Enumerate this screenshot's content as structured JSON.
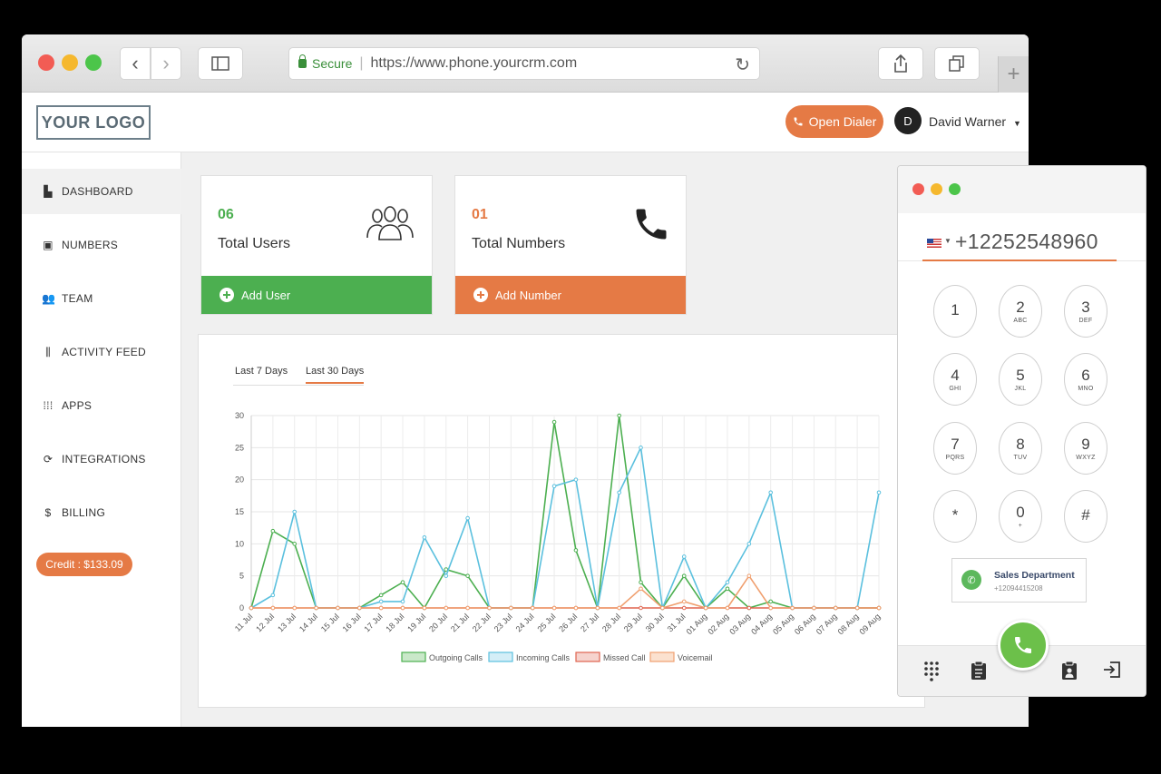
{
  "browser": {
    "url_secure": "Secure",
    "url": "https://www.phone.yourcrm.com",
    "nav_back": "‹",
    "nav_forward": "›",
    "reload": "↻",
    "new_tab": "+"
  },
  "header": {
    "logo": "YOUR LOGO",
    "open_dialer": "Open Dialer",
    "avatar_initial": "D",
    "user_name": "David Warner"
  },
  "sidebar": {
    "items": [
      {
        "label": "DASHBOARD",
        "icon": "dashboard-icon"
      },
      {
        "label": "NUMBERS",
        "icon": "numbers-icon"
      },
      {
        "label": "TEAM",
        "icon": "team-icon"
      },
      {
        "label": "ACTIVITY FEED",
        "icon": "activity-feed-icon"
      },
      {
        "label": "APPS",
        "icon": "apps-icon"
      },
      {
        "label": "INTEGRATIONS",
        "icon": "integrations-icon"
      },
      {
        "label": "BILLING",
        "icon": "billing-icon"
      }
    ],
    "credit": "Credit : $133.09"
  },
  "cards": {
    "users": {
      "count": "06",
      "label": "Total Users",
      "action": "Add User",
      "color": "#4caf50"
    },
    "numbers": {
      "count": "01",
      "label": "Total Numbers",
      "action": "Add Number",
      "color": "#e57a45"
    }
  },
  "chart_tabs": {
    "last7": "Last 7 Days",
    "last30": "Last 30 Days"
  },
  "chart_data": {
    "type": "line",
    "categories": [
      "11 Jul",
      "12 Jul",
      "13 Jul",
      "14 Jul",
      "15 Jul",
      "16 Jul",
      "17 Jul",
      "18 Jul",
      "19 Jul",
      "20 Jul",
      "21 Jul",
      "22 Jul",
      "23 Jul",
      "24 Jul",
      "25 Jul",
      "26 Jul",
      "27 Jul",
      "28 Jul",
      "29 Jul",
      "30 Jul",
      "31 Jul",
      "01 Aug",
      "02 Aug",
      "03 Aug",
      "04 Aug",
      "05 Aug",
      "06 Aug",
      "07 Aug",
      "08 Aug",
      "09 Aug"
    ],
    "ylim": [
      0,
      30
    ],
    "yticks": [
      0,
      5,
      10,
      15,
      20,
      25,
      30
    ],
    "grid": true,
    "legend_position": "bottom",
    "series": [
      {
        "name": "Outgoing Calls",
        "color": "#4caf50",
        "fill": "#c9e8c9",
        "values": [
          0,
          12,
          10,
          0,
          0,
          0,
          2,
          4,
          0,
          6,
          5,
          0,
          0,
          0,
          29,
          9,
          0,
          30,
          4,
          0,
          5,
          0,
          3,
          0,
          1,
          0,
          0,
          0,
          0,
          0
        ]
      },
      {
        "name": "Incoming Calls",
        "color": "#5bc0de",
        "fill": "#d4eef7",
        "values": [
          0,
          2,
          15,
          0,
          0,
          0,
          1,
          1,
          11,
          5,
          14,
          0,
          0,
          0,
          19,
          20,
          0,
          18,
          25,
          0,
          8,
          0,
          4,
          10,
          18,
          0,
          0,
          0,
          0,
          18
        ]
      },
      {
        "name": "Missed Call",
        "color": "#e0644f",
        "fill": "#f6d3cd",
        "values": [
          0,
          0,
          0,
          0,
          0,
          0,
          0,
          0,
          0,
          0,
          0,
          0,
          0,
          0,
          0,
          0,
          0,
          0,
          0,
          0,
          0,
          0,
          0,
          0,
          0,
          0,
          0,
          0,
          0,
          0
        ]
      },
      {
        "name": "Voicemail",
        "color": "#f0a070",
        "fill": "#fbe1cf",
        "values": [
          0,
          0,
          0,
          0,
          0,
          0,
          0,
          0,
          0,
          0,
          0,
          0,
          0,
          0,
          0,
          0,
          0,
          0,
          3,
          0,
          1,
          0,
          0,
          5,
          0,
          0,
          0,
          0,
          0,
          0
        ]
      }
    ]
  },
  "dialer": {
    "number": "+12252548960",
    "keys": [
      {
        "digit": "1",
        "letters": ""
      },
      {
        "digit": "2",
        "letters": "ABC"
      },
      {
        "digit": "3",
        "letters": "DEF"
      },
      {
        "digit": "4",
        "letters": "GHI"
      },
      {
        "digit": "5",
        "letters": "JKL"
      },
      {
        "digit": "6",
        "letters": "MNO"
      },
      {
        "digit": "7",
        "letters": "PQRS"
      },
      {
        "digit": "8",
        "letters": "TUV"
      },
      {
        "digit": "9",
        "letters": "WXYZ"
      },
      {
        "digit": "*",
        "letters": ""
      },
      {
        "digit": "0",
        "letters": "+"
      },
      {
        "digit": "#",
        "letters": ""
      }
    ],
    "caller_name": "Sales Department",
    "caller_number": "+12094415208"
  }
}
